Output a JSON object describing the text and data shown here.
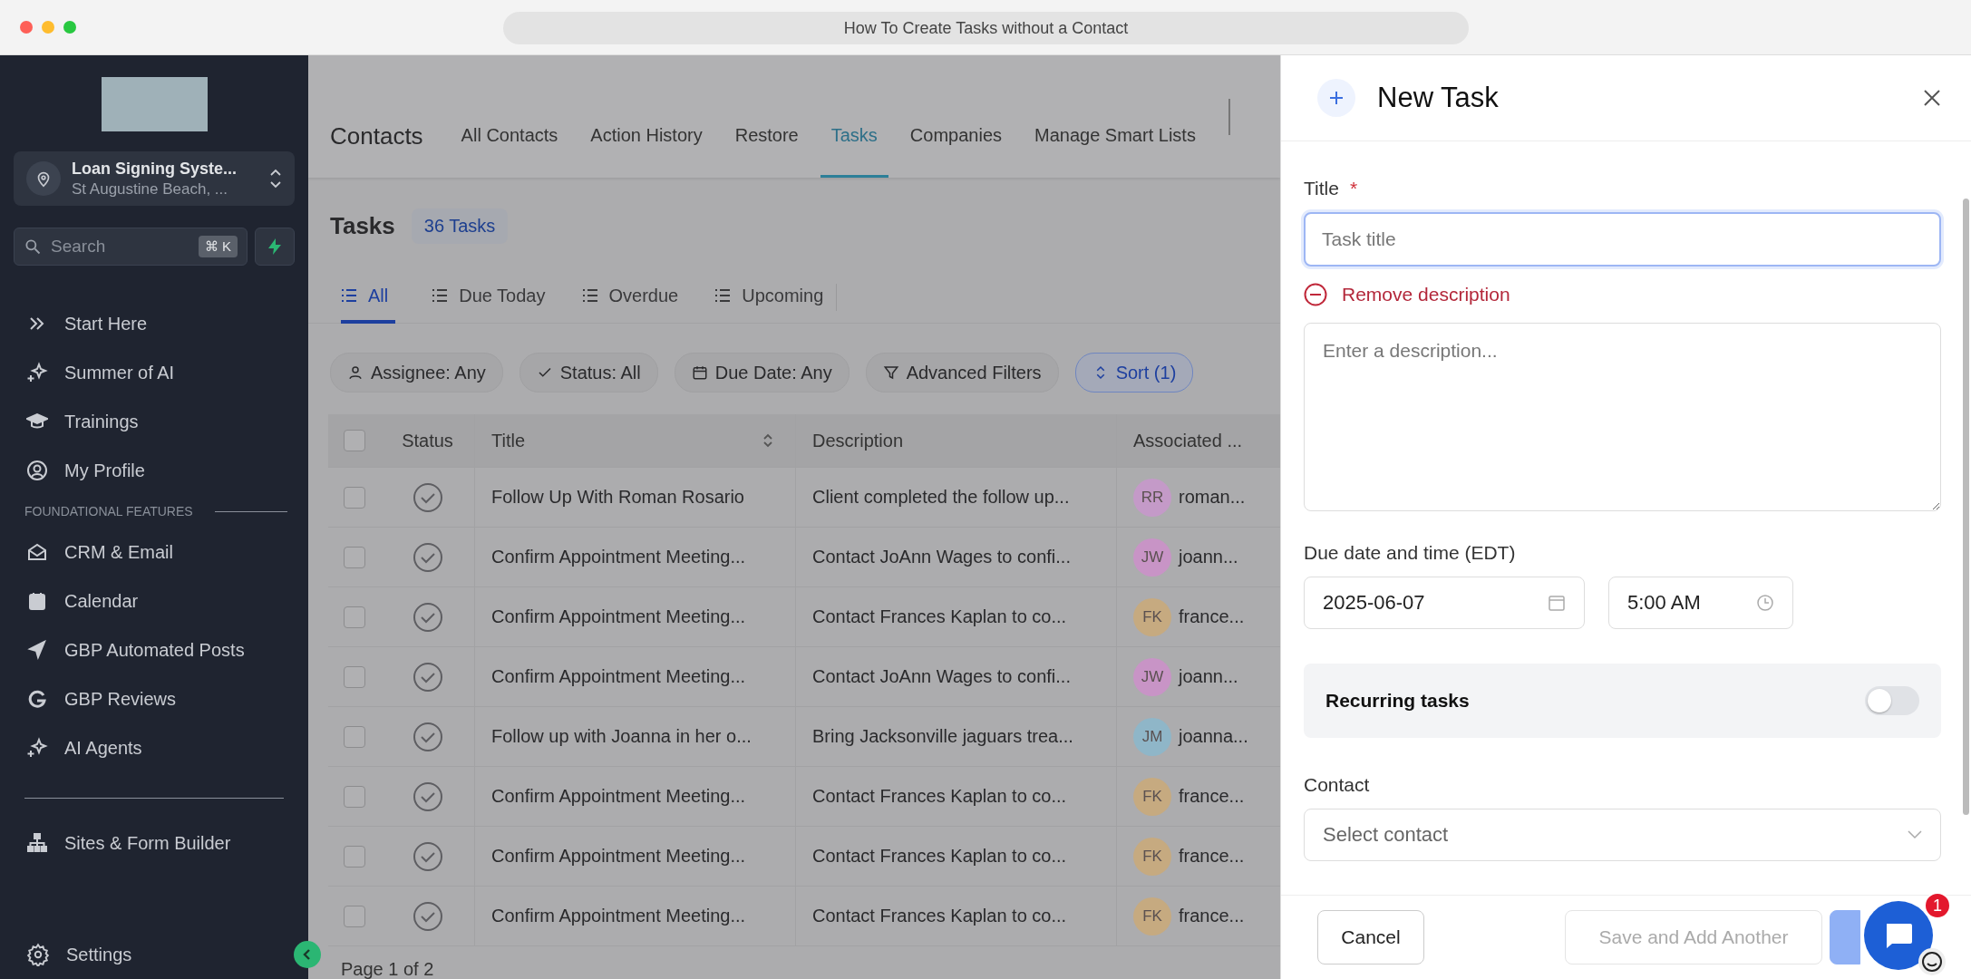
{
  "browser": {
    "title": "How To Create Tasks without a Contact"
  },
  "sidebar": {
    "account": {
      "name": "Loan Signing Syste...",
      "location": "St Augustine Beach, ..."
    },
    "search": {
      "placeholder": "Search",
      "shortcut": "⌘ K"
    },
    "items": [
      {
        "label": "Start Here",
        "kind": "chevrons"
      },
      {
        "label": "Summer of AI",
        "kind": "sparkle"
      },
      {
        "label": "Trainings",
        "kind": "cap"
      },
      {
        "label": "My Profile",
        "kind": "user"
      }
    ],
    "section_label": "FOUNDATIONAL FEATURES",
    "section_items": [
      {
        "label": "CRM & Email",
        "kind": "mail"
      },
      {
        "label": "Calendar",
        "kind": "calendar"
      },
      {
        "label": "GBP Automated Posts",
        "kind": "send"
      },
      {
        "label": "GBP Reviews",
        "kind": "g"
      },
      {
        "label": "AI Agents",
        "kind": "sparkle"
      }
    ],
    "builder_items": [
      {
        "label": "Sites & Form Builder",
        "kind": "sitemap"
      }
    ],
    "settings": {
      "label": "Settings"
    }
  },
  "header": {
    "title": "Contacts",
    "tabs": [
      {
        "label": "All Contacts",
        "selected": false
      },
      {
        "label": "Action History",
        "selected": false
      },
      {
        "label": "Restore",
        "selected": false
      },
      {
        "label": "Tasks",
        "selected": true
      },
      {
        "label": "Companies",
        "selected": false
      },
      {
        "label": "Manage Smart Lists",
        "selected": false
      }
    ]
  },
  "tasks": {
    "title": "Tasks",
    "count": "36 Tasks",
    "filters": [
      {
        "label": "All",
        "selected": true
      },
      {
        "label": "Due Today",
        "selected": false
      },
      {
        "label": "Overdue",
        "selected": false
      },
      {
        "label": "Upcoming",
        "selected": false
      }
    ],
    "chips": [
      {
        "label": "Assignee: Any",
        "kind": "person",
        "selected": false
      },
      {
        "label": "Status: All",
        "kind": "check",
        "selected": false
      },
      {
        "label": "Due Date: Any",
        "kind": "calendar",
        "selected": false
      },
      {
        "label": "Advanced Filters",
        "kind": "filter",
        "selected": false
      },
      {
        "label": "Sort (1)",
        "kind": "sort",
        "selected": true
      }
    ]
  },
  "table": {
    "all_checked": false,
    "columns": [
      "Status",
      "Title",
      "Description",
      "Associated ..."
    ],
    "rows": [
      {
        "checked": false,
        "title": "Follow Up With Roman Rosario",
        "description": "Client completed the follow up...",
        "initials": "RR",
        "contact": "roman...",
        "color": "#c49ac8"
      },
      {
        "checked": false,
        "title": "Confirm Appointment Meeting...",
        "description": "Contact JoAnn Wages to confi...",
        "initials": "JW",
        "contact": "joann...",
        "color": "#c894c6"
      },
      {
        "checked": false,
        "title": "Confirm Appointment Meeting...",
        "description": "Contact Frances Kaplan to co...",
        "initials": "FK",
        "contact": "france...",
        "color": "#c6aa80"
      },
      {
        "checked": false,
        "title": "Confirm Appointment Meeting...",
        "description": "Contact JoAnn Wages to confi...",
        "initials": "JW",
        "contact": "joann...",
        "color": "#c894c6"
      },
      {
        "checked": false,
        "title": "Follow up with Joanna in her o...",
        "description": "Bring Jacksonville jaguars trea...",
        "initials": "JM",
        "contact": "joanna...",
        "color": "#8fb6c8"
      },
      {
        "checked": false,
        "title": "Confirm Appointment Meeting...",
        "description": "Contact Frances Kaplan to co...",
        "initials": "FK",
        "contact": "france...",
        "color": "#c6aa80"
      },
      {
        "checked": false,
        "title": "Confirm Appointment Meeting...",
        "description": "Contact Frances Kaplan to co...",
        "initials": "FK",
        "contact": "france...",
        "color": "#c6aa80"
      },
      {
        "checked": false,
        "title": "Confirm Appointment Meeting...",
        "description": "Contact Frances Kaplan to co...",
        "initials": "FK",
        "contact": "france...",
        "color": "#c6aa80"
      }
    ],
    "footer": "Page 1 of 2"
  },
  "panel": {
    "title": "New Task",
    "title_label": "Title",
    "required_mark": "*",
    "title_placeholder": "Task title",
    "remove_description": "Remove description",
    "description_placeholder": "Enter a description...",
    "due_label": "Due date and time (EDT)",
    "date": "2025-06-07",
    "time": "5:00 AM",
    "recurring": {
      "label": "Recurring tasks",
      "on": false
    },
    "contact_label": "Contact",
    "contact_placeholder": "Select contact",
    "cancel": "Cancel",
    "save_another": {
      "label": "Save and Add Another",
      "disabled": true
    }
  },
  "chat": {
    "badge": "1"
  }
}
